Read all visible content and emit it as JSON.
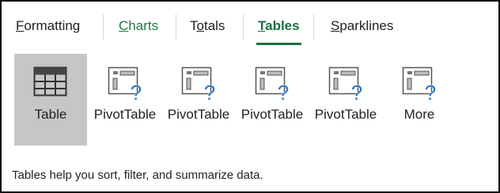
{
  "tabs": [
    {
      "label": "Formatting",
      "underline": "F"
    },
    {
      "label": "Charts",
      "underline": "C"
    },
    {
      "label": "Totals",
      "underline": "o"
    },
    {
      "label": "Tables",
      "underline": "T",
      "active": true
    },
    {
      "label": "Sparklines",
      "underline": "S"
    }
  ],
  "tiles": [
    {
      "label": "Table",
      "icon": "table-grid-icon",
      "selected": true
    },
    {
      "label": "PivotTable",
      "icon": "pivot-table-help-icon"
    },
    {
      "label": "PivotTable",
      "icon": "pivot-table-help-icon"
    },
    {
      "label": "PivotTable",
      "icon": "pivot-table-help-icon"
    },
    {
      "label": "PivotTable",
      "icon": "pivot-table-help-icon"
    },
    {
      "label": "More",
      "icon": "pivot-table-help-icon"
    }
  ],
  "footer": "Tables help you sort, filter, and summarize data.",
  "colors": {
    "accent_green": "#1d6f42",
    "charts_green": "#1f7a45",
    "selected_tile": "#c6c6c6",
    "help_blue": "#2b78c5"
  }
}
